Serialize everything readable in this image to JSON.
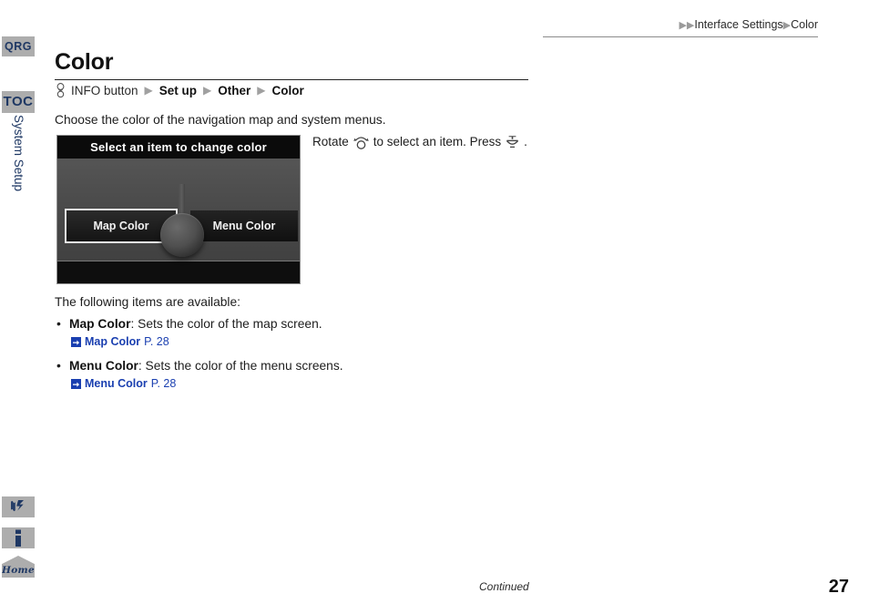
{
  "header": {
    "breadcrumb_arrow": "▶",
    "trail": [
      "Interface Settings",
      "Color"
    ]
  },
  "sidebar": {
    "tabs": [
      {
        "label": "QRG",
        "name": "qrg"
      },
      {
        "label": "TOC",
        "name": "toc"
      }
    ],
    "section_label": "System Setup",
    "buttons": [
      {
        "label": "",
        "icon": "voice-command-icon",
        "name": "voice-command"
      },
      {
        "label": "",
        "icon": "info-icon",
        "name": "info"
      },
      {
        "label": "Home",
        "icon": "home-icon",
        "name": "home"
      }
    ]
  },
  "page": {
    "title": "Color",
    "breadcrumb": {
      "button_icon": "knob-press-icon",
      "button_label": "INFO button",
      "separator": "▶",
      "steps": [
        "Set up",
        "Other",
        "Color"
      ]
    },
    "intro": "Choose the color of the navigation map and system menus.",
    "following_label": "The following items are available:",
    "items": [
      {
        "bullet": "•",
        "term": "Map Color",
        "description": ": Sets the color of the map screen.",
        "xref_icon": "link-arrow-icon",
        "xref_title": "Map Color",
        "xref_page": "P. 28"
      },
      {
        "bullet": "•",
        "term": "Menu Color",
        "description": ": Sets the color of the menu screens.",
        "xref_icon": "link-arrow-icon",
        "xref_title": "Menu Color",
        "xref_page": "P. 28"
      }
    ]
  },
  "nav_screen": {
    "titlebar": "Select an item to change color",
    "buttons": [
      {
        "label": "Map Color",
        "selected": true
      },
      {
        "label": "Menu Color",
        "selected": false
      }
    ]
  },
  "instruction": {
    "part1": "Rotate",
    "rotate_icon": "knob-rotate-icon",
    "part2": "to select an item. Press",
    "press_icon": "knob-press-icon",
    "part3": "."
  },
  "footer": {
    "continued": "Continued",
    "page_number": "27"
  },
  "colors": {
    "tab_bg": "#adadad",
    "tab_text": "#1f3864",
    "link": "#1a3fb0",
    "nav_titlebar_bg": "#0b0b0b"
  }
}
